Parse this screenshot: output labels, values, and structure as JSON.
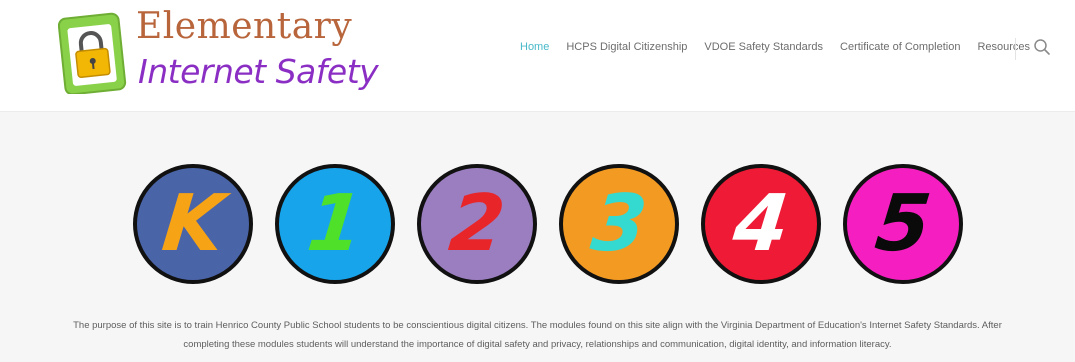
{
  "logo": {
    "line1": "Elementary",
    "line2": "Internet Safety"
  },
  "nav": {
    "items": [
      {
        "label": "Home",
        "active": true
      },
      {
        "label": "HCPS Digital Citizenship",
        "active": false
      },
      {
        "label": "VDOE Safety Standards",
        "active": false
      },
      {
        "label": "Certificate of Completion",
        "active": false
      },
      {
        "label": "Resources",
        "active": false
      }
    ],
    "search_icon": "search-icon"
  },
  "grades": [
    {
      "label": "K",
      "bg": "#4a64a8",
      "fg": "#f6a316"
    },
    {
      "label": "1",
      "bg": "#18a4ea",
      "fg": "#4fe02a"
    },
    {
      "label": "2",
      "bg": "#9b7ec0",
      "fg": "#e8262a"
    },
    {
      "label": "3",
      "bg": "#f39a23",
      "fg": "#34d9cf"
    },
    {
      "label": "4",
      "bg": "#ef1a35",
      "fg": "#ffffff"
    },
    {
      "label": "5",
      "bg": "#f51fc1",
      "fg": "#0a0a0a"
    }
  ],
  "description": {
    "line1": "The purpose of this site is to train Henrico County Public School students to be conscientious digital citizens. The modules found on this site align with the Virginia Department of Education's Internet Safety Standards. After",
    "line2": "completing these modules students will understand the importance of digital safety and privacy, relationships and communication, digital identity, and information literacy."
  }
}
